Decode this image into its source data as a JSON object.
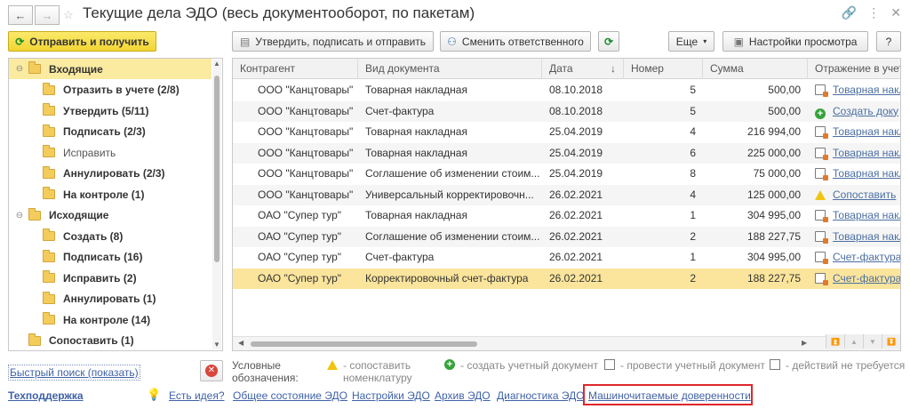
{
  "window": {
    "title": "Текущие дела ЭДО (весь документооборот, по пакетам)"
  },
  "toolbar": {
    "send_receive_label": "Отправить и получить",
    "approve_sign_send_label": "Утвердить, подписать и отправить",
    "change_responsible_label": "Сменить ответственного",
    "more_label": "Еще",
    "view_settings_label": "Настройки просмотра",
    "help_label": "?"
  },
  "tree": {
    "items": [
      {
        "label": "Входящие",
        "bold": true,
        "level": 0,
        "toggle": "⊖",
        "selected": true
      },
      {
        "label": "Отразить в учете (2/8)",
        "bold": true,
        "level": 1
      },
      {
        "label": "Утвердить (5/11)",
        "bold": true,
        "level": 1
      },
      {
        "label": "Подписать (2/3)",
        "bold": true,
        "level": 1
      },
      {
        "label": "Исправить",
        "bold": false,
        "level": 1
      },
      {
        "label": "Аннулировать (2/3)",
        "bold": true,
        "level": 1
      },
      {
        "label": "На контроле (1)",
        "bold": true,
        "level": 1
      },
      {
        "label": "Исходящие",
        "bold": true,
        "level": 0,
        "toggle": "⊖"
      },
      {
        "label": "Создать (8)",
        "bold": true,
        "level": 1
      },
      {
        "label": "Подписать (16)",
        "bold": true,
        "level": 1
      },
      {
        "label": "Исправить (2)",
        "bold": true,
        "level": 1
      },
      {
        "label": "Аннулировать (1)",
        "bold": true,
        "level": 1
      },
      {
        "label": "На контроле (14)",
        "bold": true,
        "level": 1
      },
      {
        "label": "Сопоставить (1)",
        "bold": true,
        "level": 0
      }
    ]
  },
  "table": {
    "columns": [
      "Контрагент",
      "Вид документа",
      "Дата",
      "Номер",
      "Сумма",
      "Отражение в учет"
    ],
    "sort_indicator": "↓",
    "rows": [
      {
        "counterparty": "ООО \"Канцтовары\"",
        "doc_type": "Товарная накладная",
        "date": "08.10.2018",
        "number": "5",
        "amount": "500,00",
        "status_icon": "doc",
        "status": "Товарная накла"
      },
      {
        "counterparty": "ООО \"Канцтовары\"",
        "doc_type": "Счет-фактура",
        "date": "08.10.2018",
        "number": "5",
        "amount": "500,00",
        "status_icon": "plus",
        "status": "Создать доку"
      },
      {
        "counterparty": "ООО \"Канцтовары\"",
        "doc_type": "Товарная накладная",
        "date": "25.04.2019",
        "number": "4",
        "amount": "216 994,00",
        "status_icon": "doc",
        "status": "Товарная накла"
      },
      {
        "counterparty": "ООО \"Канцтовары\"",
        "doc_type": "Товарная накладная",
        "date": "25.04.2019",
        "number": "6",
        "amount": "225 000,00",
        "status_icon": "doc",
        "status": "Товарная накла"
      },
      {
        "counterparty": "ООО \"Канцтовары\"",
        "doc_type": "Соглашение об изменении стоим...",
        "date": "25.04.2019",
        "number": "8",
        "amount": "75 000,00",
        "status_icon": "doc",
        "status": "Товарная накла"
      },
      {
        "counterparty": "ООО \"Канцтовары\"",
        "doc_type": "Универсальный корректировочн...",
        "date": "26.02.2021",
        "number": "4",
        "amount": "125 000,00",
        "status_icon": "warn",
        "status": "Сопоставить"
      },
      {
        "counterparty": "ОАО \"Супер тур\"",
        "doc_type": "Товарная накладная",
        "date": "26.02.2021",
        "number": "1",
        "amount": "304 995,00",
        "status_icon": "doc",
        "status": "Товарная накла"
      },
      {
        "counterparty": "ОАО \"Супер тур\"",
        "doc_type": "Соглашение об изменении стоим...",
        "date": "26.02.2021",
        "number": "2",
        "amount": "188 227,75",
        "status_icon": "doc",
        "status": "Товарная накла"
      },
      {
        "counterparty": "ОАО \"Супер тур\"",
        "doc_type": "Счет-фактура",
        "date": "26.02.2021",
        "number": "1",
        "amount": "304 995,00",
        "status_icon": "doc",
        "status": "Счет-фактура"
      },
      {
        "counterparty": "ОАО \"Супер тур\"",
        "doc_type": "Корректировочный счет-фактура",
        "date": "26.02.2021",
        "number": "2",
        "amount": "188 227,75",
        "status_icon": "doc",
        "status": "Счет-фактура",
        "selected": true
      }
    ]
  },
  "bottom": {
    "quick_search": "Быстрый поиск (показать)",
    "legend_title_1": "Условные",
    "legend_title_2": "обозначения:",
    "legend_match_1": "- сопоставить",
    "legend_match_2": "номенклатуру",
    "legend_create": "- создать учетный документ",
    "legend_post": "- провести учетный документ",
    "legend_no_action": "- действий не требуется"
  },
  "footer": {
    "support": "Техподдержка",
    "idea": "Есть идея?",
    "general_state": "Общее состояние ЭДО",
    "settings": "Настройки ЭДО",
    "archive": "Архив ЭДО",
    "diagnostics": "Диагностика ЭДО",
    "machine_readable": "Машиночитаемые доверенности"
  },
  "colors": {
    "accent_yellow": "#f2d533",
    "selection": "#fbe59c",
    "link": "#3f62a8",
    "highlight_border": "#e0262b"
  }
}
